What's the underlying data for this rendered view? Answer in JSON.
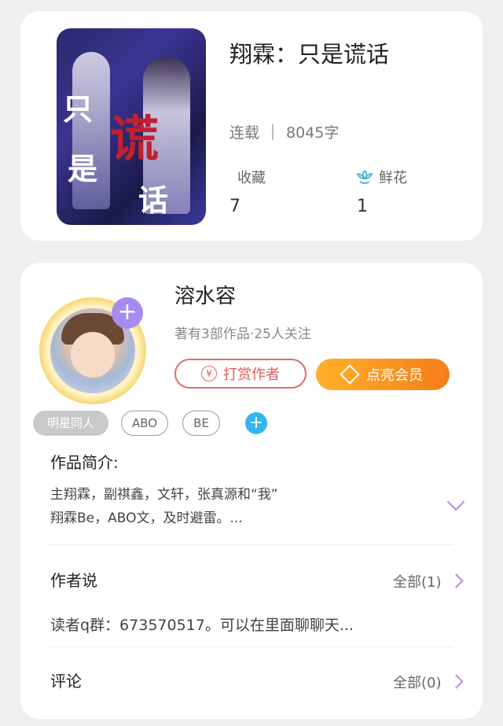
{
  "book": {
    "title": "翔霖：只是谎话",
    "cover_text": [
      "只",
      "是",
      "谎",
      "话"
    ],
    "status": "连载",
    "word_count": "8045字",
    "favorites_label": "收藏",
    "favorites_count": "7",
    "flowers_label": "鲜花",
    "flowers_count": "1"
  },
  "author": {
    "name": "溶水容",
    "stats": "著有3部作品·25人关注",
    "tip_button": "打赏作者",
    "tip_icon_glyph": "¥",
    "vip_button": "点亮会员",
    "follow_glyph": "+"
  },
  "tags": [
    "明星同人",
    "ABO",
    "BE"
  ],
  "add_tag_glyph": "+",
  "intro": {
    "title": "作品简介:",
    "line1": "主翔霖，副祺鑫，文轩，张真源和“我”",
    "line2": "翔霖Be，ABO文，及时避雷。..."
  },
  "author_says": {
    "title": "作者说",
    "more": "全部(1)",
    "text": "读者q群：673570517。可以在里面聊聊天..."
  },
  "comments": {
    "title": "评论",
    "more": "全部(0)"
  },
  "icons": {
    "flower": "flower-icon",
    "yen": "yen-icon",
    "diamond": "diamond-icon",
    "chevron_down": "chevron-down-icon",
    "chevron_right": "chevron-right-icon"
  },
  "colors": {
    "vip_gradient_start": "#ffb02b",
    "vip_gradient_end": "#f57d19",
    "tip_red": "#e26a6a",
    "accent_purple": "#a78bf0",
    "add_blue": "#32b5f0"
  }
}
